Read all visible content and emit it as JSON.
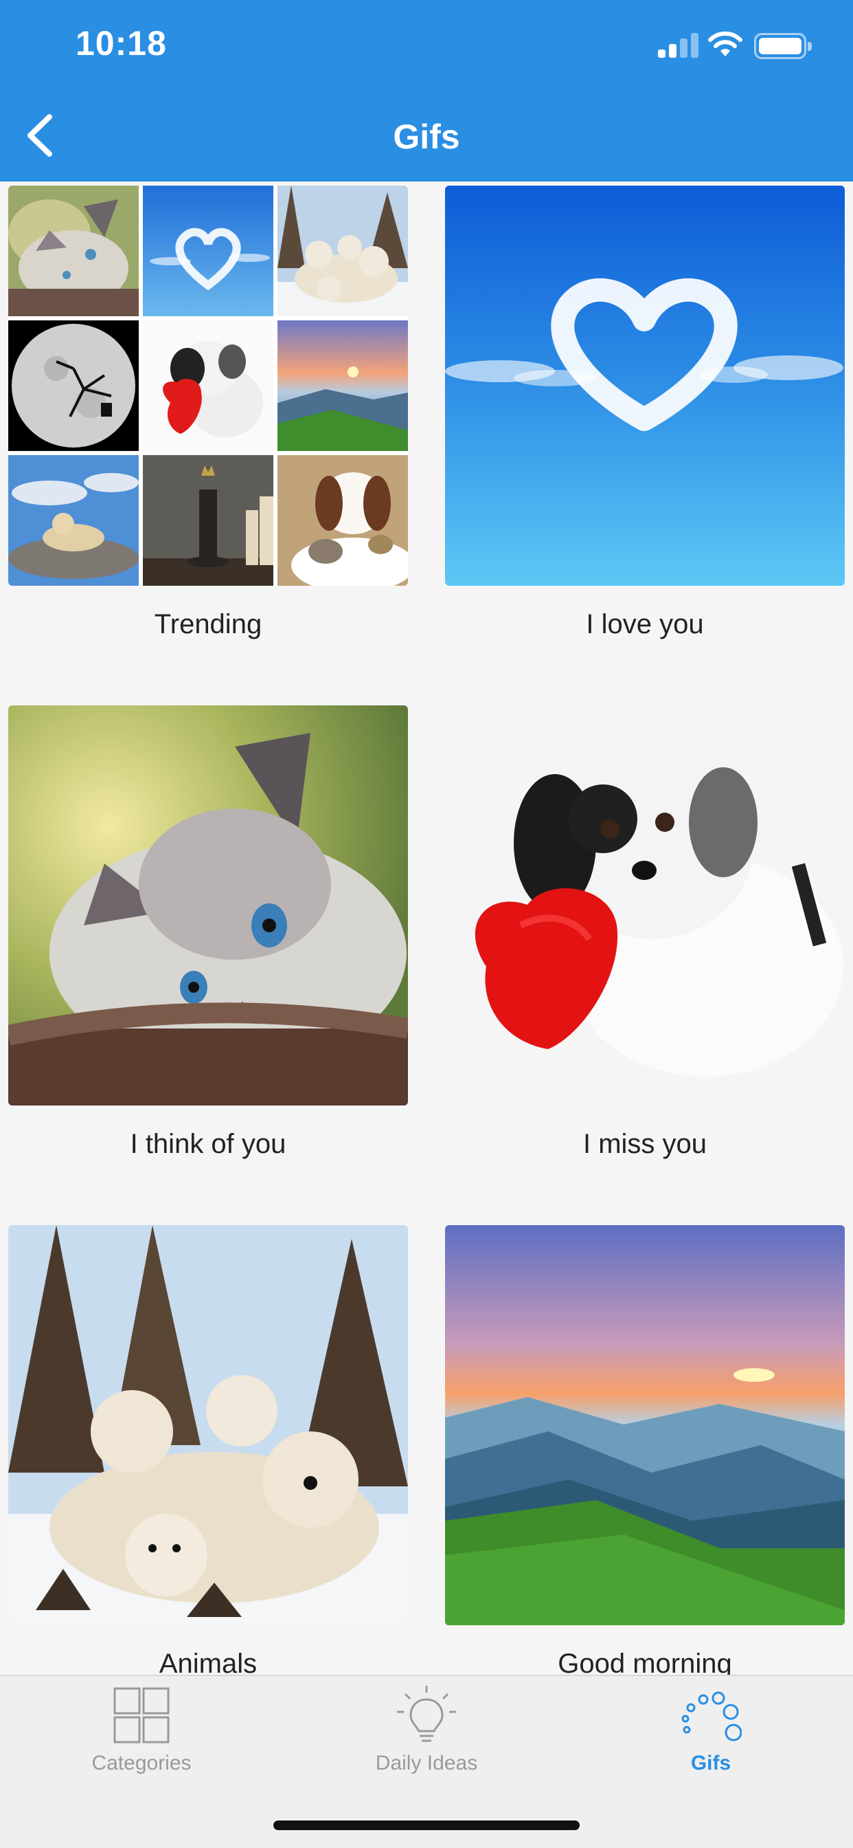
{
  "status_bar": {
    "time": "10:18"
  },
  "nav": {
    "title": "Gifs"
  },
  "cards": [
    {
      "label": "Trending"
    },
    {
      "label": "I love you"
    },
    {
      "label": "I think of you"
    },
    {
      "label": "I miss you"
    },
    {
      "label": "Animals"
    },
    {
      "label": "Good morning"
    }
  ],
  "tabbar": {
    "tabs": [
      {
        "label": "Categories",
        "icon": "grid-icon",
        "active": false
      },
      {
        "label": "Daily Ideas",
        "icon": "lightbulb-icon",
        "active": false
      },
      {
        "label": "Gifs",
        "icon": "bubbles-icon",
        "active": true
      }
    ]
  },
  "colors": {
    "accent": "#2a8ee3",
    "inactive": "#9a9a9a",
    "background": "#f5f5f5"
  }
}
